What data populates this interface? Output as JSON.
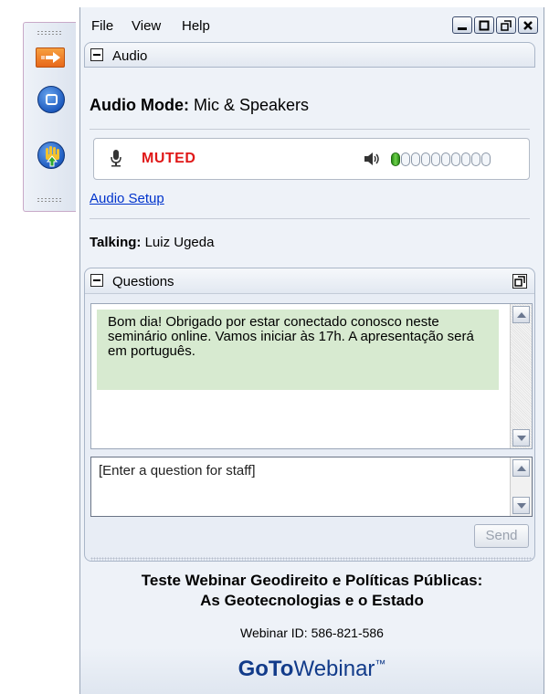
{
  "menu": {
    "file": "File",
    "view": "View",
    "help": "Help"
  },
  "audio": {
    "header": "Audio",
    "mode_label": "Audio Mode:",
    "mode_value": "Mic & Speakers",
    "status": "MUTED",
    "meter_level": 0.1,
    "setup_link": "Audio Setup",
    "talking_label": "Talking:",
    "talking_name": "Luiz Ugeda"
  },
  "questions": {
    "header": "Questions",
    "message": "Bom dia! Obrigado por estar conectado conosco neste seminário online. Vamos iniciar às 17h. A apresentação será em português.",
    "input_placeholder": "[Enter a question for staff]",
    "send_label": "Send"
  },
  "webinar": {
    "title_line1": "Teste Webinar Geodireito e Políticas Públicas:",
    "title_line2": "As Geotecnologias e o Estado",
    "id_text": "Webinar ID: 586-821-586"
  },
  "brand": {
    "goto": "GoTo",
    "webinar": "Webinar",
    "tm": "™"
  },
  "colors": {
    "muted": "#e01818",
    "link": "#0033cc",
    "message_bg": "#d7ead0",
    "brand": "#123b8a"
  }
}
